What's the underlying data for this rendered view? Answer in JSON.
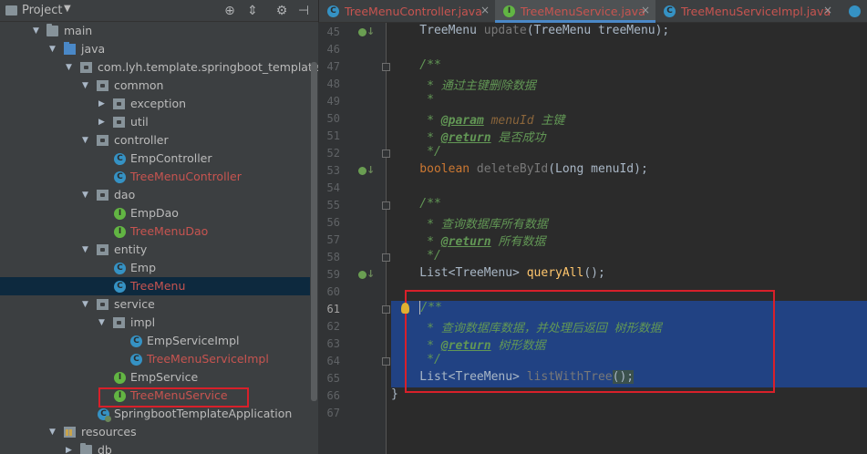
{
  "project_panel": {
    "title": "Project",
    "tree": [
      {
        "label": "main",
        "icon": "folder-icon",
        "expanded": true
      },
      {
        "label": "java",
        "icon": "source-folder-icon",
        "expanded": true
      },
      {
        "label": "com.lyh.template.springboot_template",
        "icon": "package-icon",
        "expanded": true
      },
      {
        "label": "common",
        "icon": "package-icon",
        "expanded": true
      },
      {
        "label": "exception",
        "icon": "package-icon",
        "expanded": false
      },
      {
        "label": "util",
        "icon": "package-icon",
        "expanded": false
      },
      {
        "label": "controller",
        "icon": "package-icon",
        "expanded": true
      },
      {
        "label": "EmpController",
        "icon": "class-icon",
        "icon_letter": "C"
      },
      {
        "label": "TreeMenuController",
        "icon": "class-icon",
        "icon_letter": "C",
        "modified": true
      },
      {
        "label": "dao",
        "icon": "package-icon",
        "expanded": true
      },
      {
        "label": "EmpDao",
        "icon": "interface-icon",
        "icon_letter": "I"
      },
      {
        "label": "TreeMenuDao",
        "icon": "interface-icon",
        "icon_letter": "I",
        "modified": true
      },
      {
        "label": "entity",
        "icon": "package-icon",
        "expanded": true
      },
      {
        "label": "Emp",
        "icon": "class-icon",
        "icon_letter": "C"
      },
      {
        "label": "TreeMenu",
        "icon": "class-icon",
        "icon_letter": "C",
        "modified": true,
        "selected": true
      },
      {
        "label": "service",
        "icon": "package-icon",
        "expanded": true
      },
      {
        "label": "impl",
        "icon": "package-icon",
        "expanded": true
      },
      {
        "label": "EmpServiceImpl",
        "icon": "class-icon",
        "icon_letter": "C"
      },
      {
        "label": "TreeMenuServiceImpl",
        "icon": "class-icon",
        "icon_letter": "C",
        "modified": true
      },
      {
        "label": "EmpService",
        "icon": "interface-icon",
        "icon_letter": "I"
      },
      {
        "label": "TreeMenuService",
        "icon": "interface-icon",
        "icon_letter": "I",
        "modified": true
      },
      {
        "label": "SpringbootTemplateApplication",
        "icon": "spring-boot-class-icon",
        "icon_letter": "C"
      },
      {
        "label": "resources",
        "icon": "resources-folder-icon",
        "expanded": true
      },
      {
        "label": "db",
        "icon": "folder-icon",
        "expanded": false
      }
    ]
  },
  "editor": {
    "tabs": [
      {
        "label": "TreeMenuController.java",
        "icon_letter": "C",
        "icon_color": "#3592c4",
        "active": false
      },
      {
        "label": "TreeMenuService.java",
        "icon_letter": "I",
        "icon_color": "#62b543",
        "active": true
      },
      {
        "label": "TreeMenuServiceImpl.java",
        "icon_letter": "C",
        "icon_color": "#3592c4",
        "active": false
      }
    ],
    "current_line": "61",
    "lines": [
      {
        "n": "45",
        "tokens": [
          [
            "plain",
            "    TreeMenu "
          ],
          [
            "gray",
            "update"
          ],
          [
            "plain",
            "(TreeMenu treeMenu);"
          ]
        ]
      },
      {
        "n": "46",
        "tokens": []
      },
      {
        "n": "47",
        "tokens": [
          [
            "doc",
            "    /**"
          ]
        ]
      },
      {
        "n": "48",
        "tokens": [
          [
            "doc",
            "     * 通过主键删除数据"
          ]
        ]
      },
      {
        "n": "49",
        "tokens": [
          [
            "doc",
            "     *"
          ]
        ]
      },
      {
        "n": "50",
        "tokens": [
          [
            "doc",
            "     * "
          ],
          [
            "tag",
            "@param"
          ],
          [
            "tagval",
            " menuId"
          ],
          [
            "doc",
            " 主键"
          ]
        ]
      },
      {
        "n": "51",
        "tokens": [
          [
            "doc",
            "     * "
          ],
          [
            "tag",
            "@return"
          ],
          [
            "doc",
            " 是否成功"
          ]
        ]
      },
      {
        "n": "52",
        "tokens": [
          [
            "doc",
            "     */"
          ]
        ]
      },
      {
        "n": "53",
        "tokens": [
          [
            "kw",
            "    boolean "
          ],
          [
            "gray",
            "deleteById"
          ],
          [
            "plain",
            "(Long menuId);"
          ]
        ]
      },
      {
        "n": "54",
        "tokens": []
      },
      {
        "n": "55",
        "tokens": [
          [
            "doc",
            "    /**"
          ]
        ]
      },
      {
        "n": "56",
        "tokens": [
          [
            "doc",
            "     * 查询数据库所有数据"
          ]
        ]
      },
      {
        "n": "57",
        "tokens": [
          [
            "doc",
            "     * "
          ],
          [
            "tag",
            "@return"
          ],
          [
            "doc",
            " 所有数据"
          ]
        ]
      },
      {
        "n": "58",
        "tokens": [
          [
            "doc",
            "     */"
          ]
        ]
      },
      {
        "n": "59",
        "tokens": [
          [
            "plain",
            "    List<TreeMenu> "
          ],
          [
            "method",
            "queryAll"
          ],
          [
            "plain",
            "();"
          ]
        ]
      },
      {
        "n": "60",
        "tokens": []
      },
      {
        "n": "61",
        "tokens": [
          [
            "plain",
            "    "
          ],
          [
            "doc",
            "/**"
          ]
        ]
      },
      {
        "n": "62",
        "tokens": [
          [
            "doc",
            "     * 查询数据库数据，并处理后返回 树形数据"
          ]
        ]
      },
      {
        "n": "63",
        "tokens": [
          [
            "doc",
            "     * "
          ],
          [
            "tag",
            "@return"
          ],
          [
            "doc",
            " 树形数据"
          ]
        ]
      },
      {
        "n": "64",
        "tokens": [
          [
            "doc",
            "     */"
          ]
        ]
      },
      {
        "n": "65",
        "tokens": [
          [
            "plain",
            "    List<TreeMenu> "
          ],
          [
            "gray",
            "listWithTree"
          ],
          [
            "plain",
            "();"
          ]
        ]
      },
      {
        "n": "66",
        "tokens": [
          [
            "plain",
            "}"
          ]
        ]
      },
      {
        "n": "67",
        "tokens": []
      }
    ]
  },
  "colors": {
    "panel_bg": "#3c3f41",
    "editor_bg": "#2b2b2b",
    "selection": "#214283",
    "modified_file": "#c75450",
    "annotation_box": "#d8202a"
  }
}
